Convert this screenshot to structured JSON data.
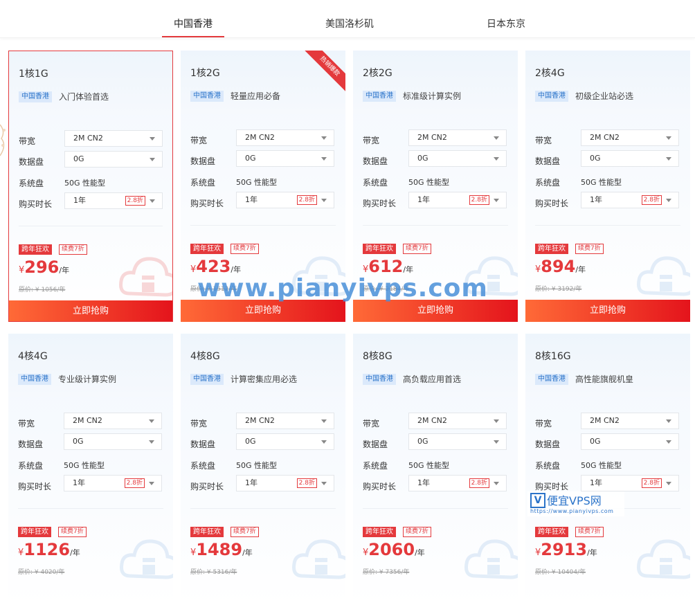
{
  "tabs": [
    {
      "label": "中国香港",
      "active": true
    },
    {
      "label": "美国洛杉矶",
      "active": false
    },
    {
      "label": "日本东京",
      "active": false
    }
  ],
  "labels": {
    "bandwidth": "带宽",
    "data_disk": "数据盘",
    "system_disk": "系统盘",
    "duration": "购买时长",
    "buy": "立即抢购",
    "promo": "跨年狂欢",
    "renew": "续费7折",
    "region_tag": "中国香港",
    "currency": "¥",
    "per_year": "/年",
    "hot": "热销爆款"
  },
  "cards": [
    {
      "name": "1核1G",
      "desc": "入门体验首选",
      "bandwidth": "2M CN2",
      "data_disk": "0G",
      "system_disk": "50G 性能型",
      "duration": "1年",
      "discount": "2.8折",
      "price": "296",
      "original": "原价: ¥ 1056/年",
      "selected": true,
      "hot": false
    },
    {
      "name": "1核2G",
      "desc": "轻量应用必备",
      "bandwidth": "2M CN2",
      "data_disk": "0G",
      "system_disk": "50G 性能型",
      "duration": "1年",
      "discount": "2.8折",
      "price": "423",
      "original": "原价: ¥ 1512/年",
      "selected": false,
      "hot": true
    },
    {
      "name": "2核2G",
      "desc": "标准级计算实例",
      "bandwidth": "2M CN2",
      "data_disk": "0G",
      "system_disk": "50G 性能型",
      "duration": "1年",
      "discount": "2.8折",
      "price": "612",
      "original": "原价: ¥ 2184/年",
      "selected": false,
      "hot": false
    },
    {
      "name": "2核4G",
      "desc": "初级企业站必选",
      "bandwidth": "2M CN2",
      "data_disk": "0G",
      "system_disk": "50G 性能型",
      "duration": "1年",
      "discount": "2.8折",
      "price": "894",
      "original": "原价: ¥ 3192/年",
      "selected": false,
      "hot": false
    },
    {
      "name": "4核4G",
      "desc": "专业级计算实例",
      "bandwidth": "2M CN2",
      "data_disk": "0G",
      "system_disk": "50G 性能型",
      "duration": "1年",
      "discount": "2.8折",
      "price": "1126",
      "original": "原价: ¥ 4020/年",
      "selected": false,
      "hot": false
    },
    {
      "name": "4核8G",
      "desc": "计算密集应用必选",
      "bandwidth": "2M CN2",
      "data_disk": "0G",
      "system_disk": "50G 性能型",
      "duration": "1年",
      "discount": "2.8折",
      "price": "1489",
      "original": "原价: ¥ 5316/年",
      "selected": false,
      "hot": false
    },
    {
      "name": "8核8G",
      "desc": "高负载应用首选",
      "bandwidth": "2M CN2",
      "data_disk": "0G",
      "system_disk": "50G 性能型",
      "duration": "1年",
      "discount": "2.8折",
      "price": "2060",
      "original": "原价: ¥ 7356/年",
      "selected": false,
      "hot": false
    },
    {
      "name": "8核16G",
      "desc": "高性能旗舰机皇",
      "bandwidth": "2M CN2",
      "data_disk": "0G",
      "system_disk": "50G 性能型",
      "duration": "1年",
      "discount": "2.8折",
      "price": "2913",
      "original": "原价: ¥ 10404/年",
      "selected": false,
      "hot": false
    }
  ],
  "watermark": "www.pianyivps.com",
  "logo": {
    "mark": "V",
    "text": "便宜VPS网",
    "url": "https://www.pianyivps.com"
  },
  "colors": {
    "accent": "#e4393c",
    "tag_blue": "#2a73c9"
  }
}
